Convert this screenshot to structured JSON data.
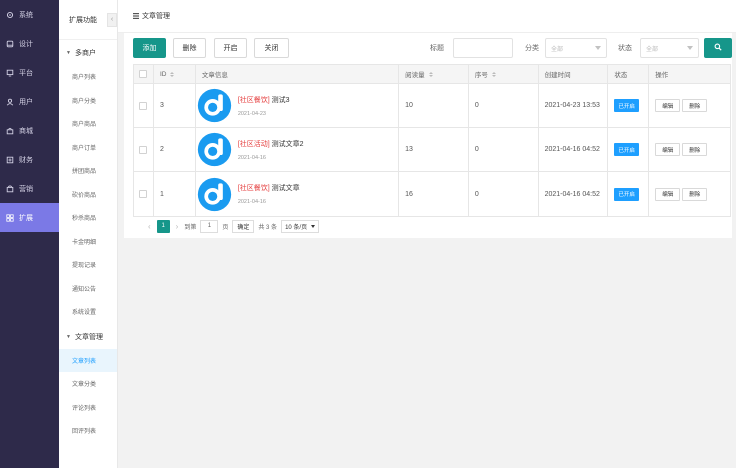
{
  "rail": {
    "items": [
      {
        "label": "系统",
        "icon": "gear-icon"
      },
      {
        "label": "设计",
        "icon": "design-icon"
      },
      {
        "label": "平台",
        "icon": "platform-icon"
      },
      {
        "label": "用户",
        "icon": "user-icon"
      },
      {
        "label": "商城",
        "icon": "shop-icon"
      },
      {
        "label": "财务",
        "icon": "finance-icon"
      },
      {
        "label": "营销",
        "icon": "marketing-icon"
      },
      {
        "label": "扩展",
        "icon": "extension-icon",
        "active": true
      }
    ]
  },
  "subnav": {
    "title": "扩展功能",
    "collapse_glyph": "‹",
    "groups": [
      {
        "title": "多商户",
        "items": [
          "商户列表",
          "商户分类",
          "商户商品",
          "商户订单",
          "拼团商品",
          "砍价商品",
          "秒杀商品",
          "卡金明细",
          "提现记录",
          "通知公告",
          "系统设置"
        ]
      },
      {
        "title": "文章管理",
        "items": [
          "文章列表",
          "文章分类",
          "评论列表",
          "回评列表"
        ]
      }
    ],
    "active_item": "文章列表"
  },
  "breadcrumb": {
    "label": "文章管理"
  },
  "toolbar": {
    "add_label": "添加",
    "delete_label": "删除",
    "enable_label": "开启",
    "disable_label": "关闭",
    "title_label": "标题",
    "title_placeholder": "",
    "category_label": "分类",
    "category_value": "全部",
    "status_label": "状态",
    "status_value": "全部"
  },
  "table": {
    "headers": [
      "ID",
      "文章信息",
      "阅读量",
      "序号",
      "创建时间",
      "状态",
      "操作"
    ],
    "rows": [
      {
        "id": "3",
        "tag": "[社区餐饮]",
        "title": "测试3",
        "date": "2021-04-23",
        "views": "10",
        "order": "0",
        "created": "2021-04-23 13:53",
        "status": "已开启"
      },
      {
        "id": "2",
        "tag": "[社区活动]",
        "title": "测试文章2",
        "date": "2021-04-16",
        "views": "13",
        "order": "0",
        "created": "2021-04-16 04:52",
        "status": "已开启"
      },
      {
        "id": "1",
        "tag": "[社区餐饮]",
        "title": "测试文章",
        "date": "2021-04-16",
        "views": "16",
        "order": "0",
        "created": "2021-04-16 04:52",
        "status": "已开启"
      }
    ],
    "edit_label": "编辑",
    "delete_label": "删除"
  },
  "pager": {
    "current": "1",
    "goto_label": "到第",
    "goto_value": "1",
    "page_unit": "页",
    "confirm_label": "确定",
    "total": "共 3 条",
    "page_size": "10 条/页"
  },
  "colors": {
    "rail_bg": "#2e2a4a",
    "rail_active": "#7b79e6",
    "primary": "#16968a",
    "status_blue": "#1e9fff",
    "tag_red": "#e53e3e"
  }
}
